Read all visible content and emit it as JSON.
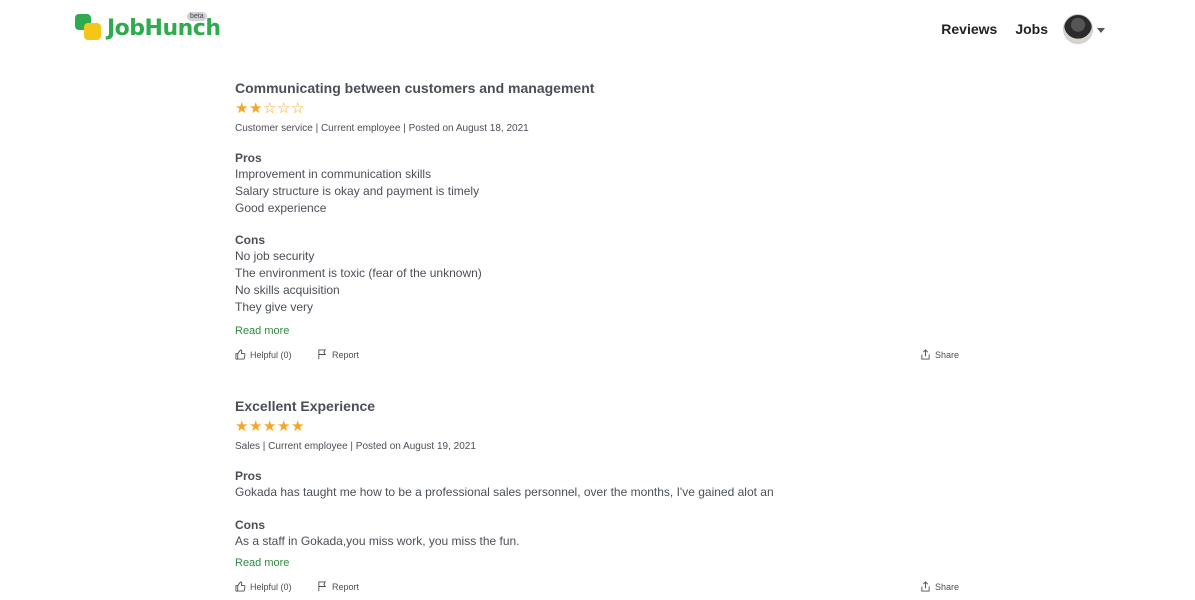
{
  "header": {
    "logo_text": "JobHunch",
    "beta_label": "beta",
    "nav": {
      "reviews": "Reviews",
      "jobs": "Jobs"
    }
  },
  "colors": {
    "brand_green": "#2eaa4f",
    "brand_yellow": "#f5c518",
    "star": "#f6a623",
    "link": "#2e8b3e"
  },
  "reviews": [
    {
      "title": "Communicating between customers and management",
      "rating": 2,
      "max_rating": 5,
      "meta": "Customer service  | Current employee |  Posted on August 18, 2021",
      "pros_label": "Pros",
      "pros": [
        "Improvement in communication skills",
        "Salary structure is okay and payment is timely",
        "Good experience"
      ],
      "cons_label": "Cons",
      "cons": [
        "No job security",
        "The environment is toxic (fear of the unknown)",
        "No skills acquisition",
        "They give very"
      ],
      "read_more": "Read more",
      "helpful": "Helpful (0)",
      "report": "Report",
      "share": "Share"
    },
    {
      "title": "Excellent Experience",
      "rating": 5,
      "max_rating": 5,
      "meta": "Sales | Current employee |  Posted on August 19, 2021",
      "pros_label": "Pros",
      "pros": [
        "Gokada has taught me how to be a professional sales personnel,  over the months, I've gained alot an"
      ],
      "cons_label": "Cons",
      "cons": [
        "As a staff in Gokada,you miss work, you miss the fun."
      ],
      "read_more": "Read more",
      "helpful": "Helpful (0)",
      "report": "Report",
      "share": "Share"
    }
  ]
}
